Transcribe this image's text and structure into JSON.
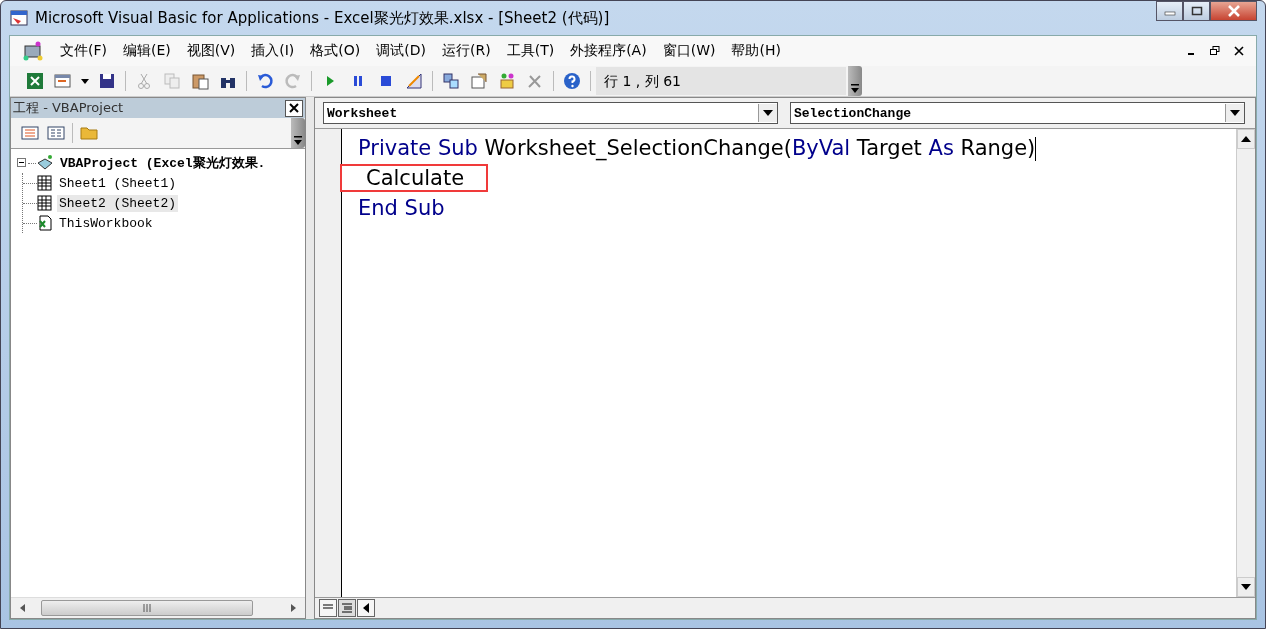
{
  "window": {
    "title": "Microsoft Visual Basic for Applications - Excel聚光灯效果.xlsx - [Sheet2 (代码)]"
  },
  "menu": [
    {
      "label": "文件(F)"
    },
    {
      "label": "编辑(E)"
    },
    {
      "label": "视图(V)"
    },
    {
      "label": "插入(I)"
    },
    {
      "label": "格式(O)"
    },
    {
      "label": "调试(D)"
    },
    {
      "label": "运行(R)"
    },
    {
      "label": "工具(T)"
    },
    {
      "label": "外接程序(A)"
    },
    {
      "label": "窗口(W)"
    },
    {
      "label": "帮助(H)"
    }
  ],
  "toolbar": {
    "position": "行 1 , 列 61"
  },
  "project_pane": {
    "title": "工程 - VBAProject",
    "tree": [
      {
        "label": "VBAProject (Excel聚光灯效果.",
        "kind": "project",
        "expanded": true,
        "selected": false,
        "children": [
          {
            "label": "Sheet1 (Sheet1)",
            "kind": "sheet",
            "selected": false
          },
          {
            "label": "Sheet2 (Sheet2)",
            "kind": "sheet",
            "selected": true
          },
          {
            "label": "ThisWorkbook",
            "kind": "workbook",
            "selected": false
          }
        ]
      }
    ]
  },
  "code_window": {
    "object": "Worksheet",
    "procedure": "SelectionChange",
    "lines": [
      {
        "boxed": false,
        "tokens": [
          {
            "text": "Private Sub",
            "kind": "keyword"
          },
          {
            "text": " Worksheet_SelectionChange(",
            "kind": "plain"
          },
          {
            "text": "ByVal",
            "kind": "keyword"
          },
          {
            "text": " Target ",
            "kind": "plain"
          },
          {
            "text": "As",
            "kind": "keyword"
          },
          {
            "text": " Range)",
            "kind": "plain"
          }
        ]
      },
      {
        "boxed": true,
        "tokens": [
          {
            "text": "Calculate",
            "kind": "plain"
          }
        ]
      },
      {
        "boxed": false,
        "tokens": [
          {
            "text": "End Sub",
            "kind": "keyword"
          }
        ]
      }
    ]
  }
}
